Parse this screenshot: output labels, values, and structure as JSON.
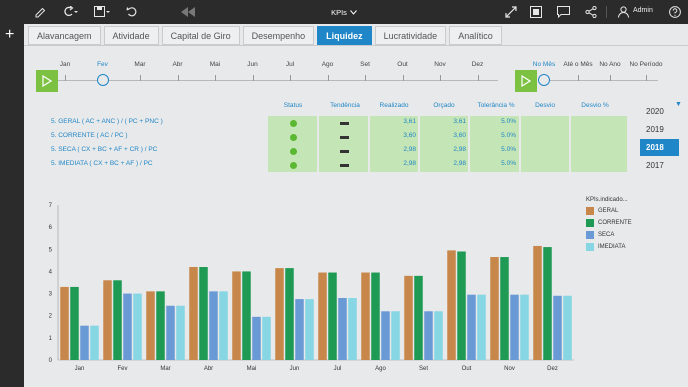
{
  "topbar": {
    "title": "KPIs",
    "user": "Admin",
    "icons": [
      "edit-icon",
      "refresh-icon",
      "save-icon",
      "undo-icon",
      "rewind-icon",
      "expand-icon",
      "export-icon",
      "comment-icon",
      "share-icon",
      "user-icon",
      "help-icon"
    ]
  },
  "tabs": [
    {
      "label": "Alavancagem",
      "active": false
    },
    {
      "label": "Atividade",
      "active": false
    },
    {
      "label": "Capital de Giro",
      "active": false
    },
    {
      "label": "Desempenho",
      "active": false
    },
    {
      "label": "Liquidez",
      "active": true
    },
    {
      "label": "Lucratividade",
      "active": false
    },
    {
      "label": "Analítico",
      "active": false
    }
  ],
  "timeline": {
    "months": [
      "Jan",
      "Fev",
      "Mar",
      "Abr",
      "Mai",
      "Jun",
      "Jul",
      "Ago",
      "Set",
      "Out",
      "Nov",
      "Dez"
    ],
    "selected_month": "Fev",
    "periods": [
      "No Mês",
      "Até o Mês",
      "No Ano",
      "No Período"
    ],
    "selected_period": "No Mês"
  },
  "kpi_table": {
    "headers": [
      "Status",
      "Tendência",
      "Realizado",
      "Orçado",
      "Tolerância %",
      "Desvio",
      "Desvio %"
    ],
    "rows": [
      {
        "name": "5. GERAL ( AC + ANC ) / ( PC + PNC )",
        "realizado": "3,61",
        "orcado": "3,61",
        "tolerancia": "5.0%"
      },
      {
        "name": "5. CORRENTE ( AC / PC )",
        "realizado": "3,60",
        "orcado": "3,60",
        "tolerancia": "5.0%"
      },
      {
        "name": "5. SECA ( CX + BC + AF + CR ) / PC",
        "realizado": "2,98",
        "orcado": "2,98",
        "tolerancia": "5.0%"
      },
      {
        "name": "5. IMEDIATA ( CX + BC + AF ) / PC",
        "realizado": "2,98",
        "orcado": "2,98",
        "tolerancia": "5.0%"
      }
    ]
  },
  "years": [
    "2020",
    "2019",
    "2018",
    "2017"
  ],
  "selected_year": "2018",
  "colors": {
    "accent": "#1f86c7",
    "green": "#7cc142",
    "geral": "#c8874a",
    "corrente": "#1f9a55",
    "seca": "#6a9ad6",
    "imediata": "#86d6e3"
  },
  "chart_data": {
    "type": "bar",
    "categories": [
      "Jan",
      "Fev",
      "Mar",
      "Abr",
      "Mai",
      "Jun",
      "Jul",
      "Ago",
      "Set",
      "Out",
      "Nov",
      "Dez"
    ],
    "ylim": [
      0,
      7
    ],
    "yticks": [
      "0",
      "1",
      "2",
      "3",
      "4",
      "5",
      "6",
      "7"
    ],
    "legend_title": "KPIs.indicado...",
    "series": [
      {
        "name": "GERAL",
        "color": "#c8874a",
        "values": [
          3.3,
          3.6,
          3.1,
          4.2,
          4.0,
          4.15,
          3.95,
          3.95,
          3.8,
          4.95,
          4.65,
          5.15
        ]
      },
      {
        "name": "CORRENTE",
        "color": "#1f9a55",
        "values": [
          3.3,
          3.6,
          3.1,
          4.2,
          4.0,
          4.15,
          3.95,
          3.95,
          3.8,
          4.9,
          4.65,
          5.1
        ]
      },
      {
        "name": "SECA",
        "color": "#6a9ad6",
        "values": [
          1.55,
          3.0,
          2.45,
          3.1,
          1.95,
          2.75,
          2.8,
          2.2,
          2.2,
          2.95,
          2.95,
          2.9
        ]
      },
      {
        "name": "IMEDIATA",
        "color": "#86d6e3",
        "values": [
          1.55,
          3.0,
          2.45,
          3.1,
          1.95,
          2.75,
          2.8,
          2.2,
          2.2,
          2.95,
          2.95,
          2.9
        ]
      }
    ]
  }
}
